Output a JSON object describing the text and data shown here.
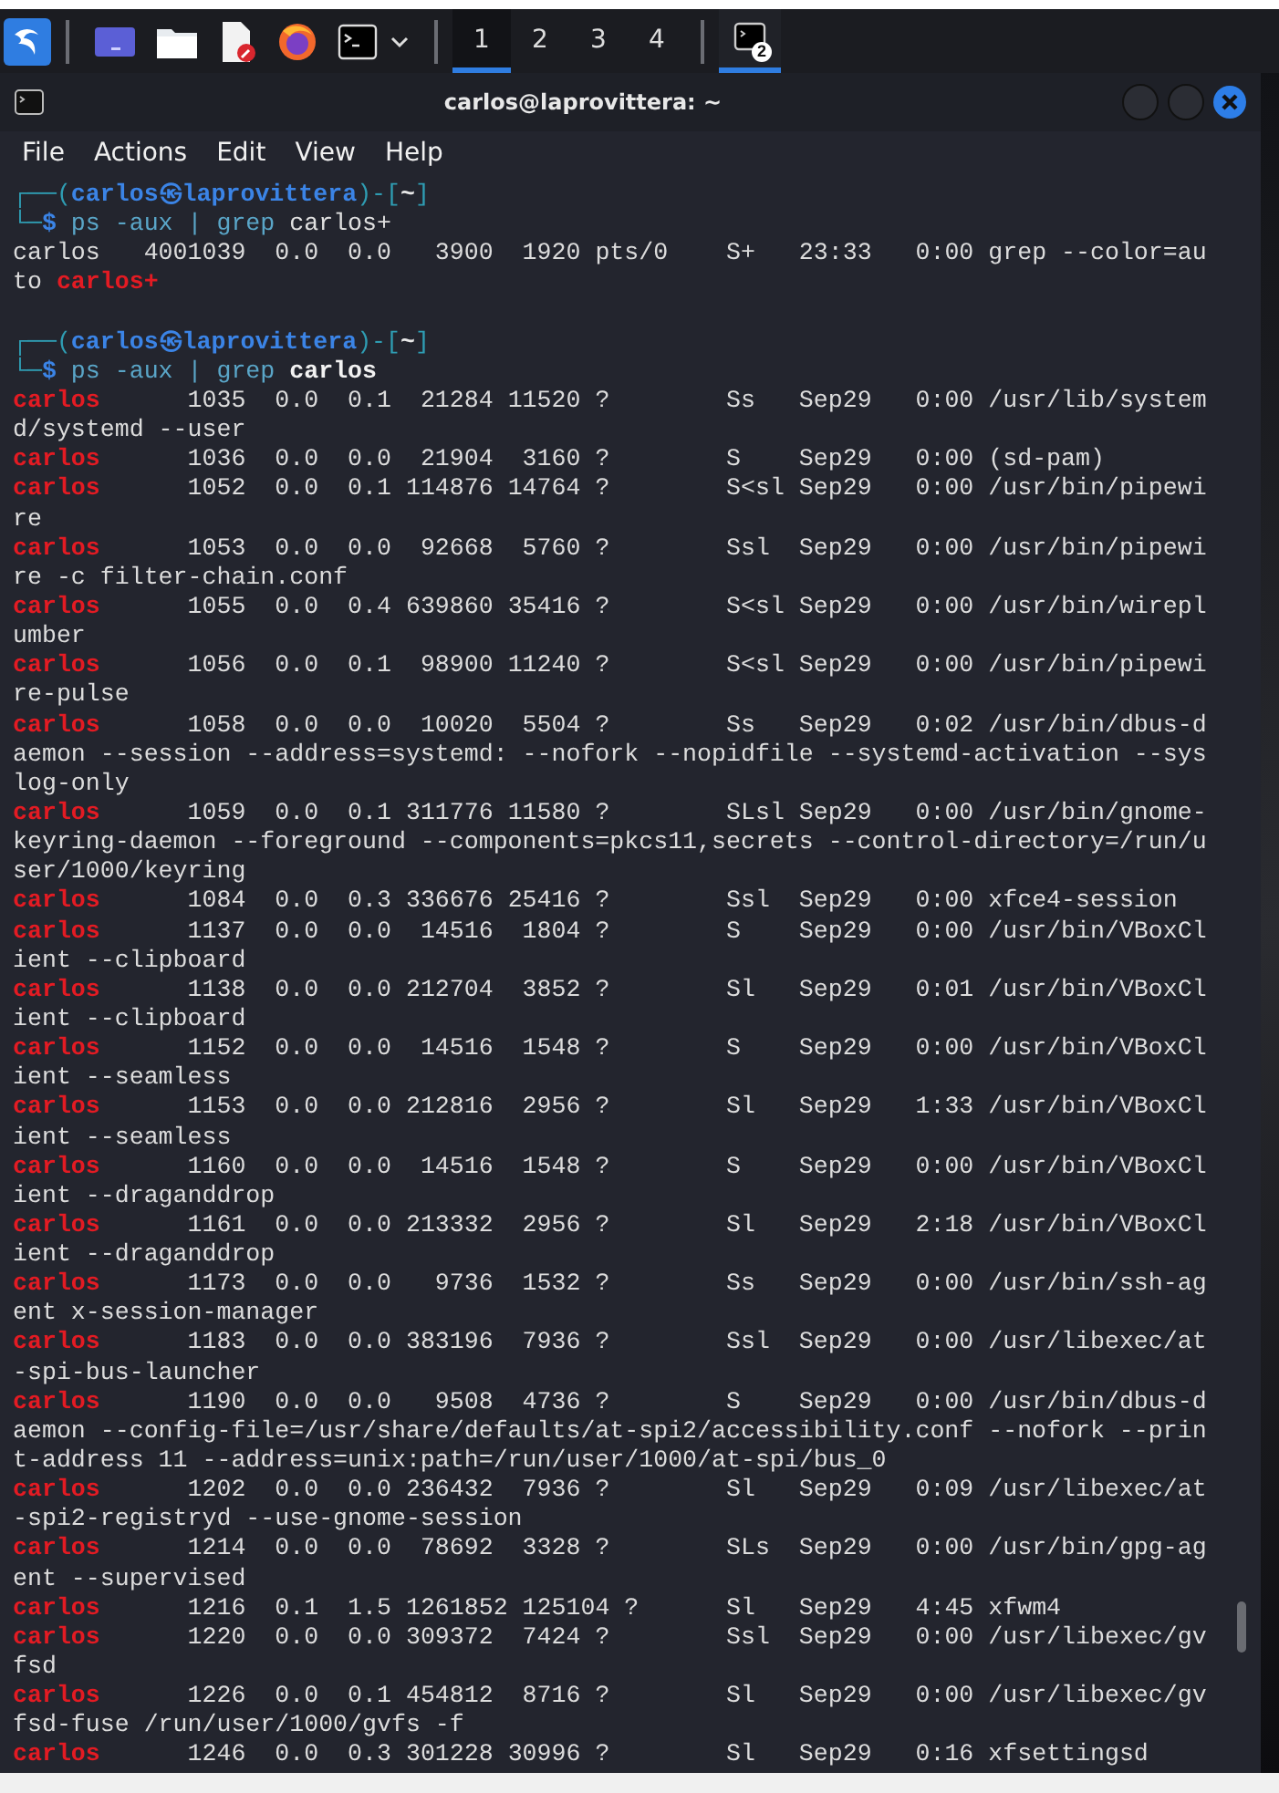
{
  "taskbar": {
    "workspaces": [
      {
        "label": "1",
        "selected": true
      },
      {
        "label": "2",
        "selected": false
      },
      {
        "label": "3",
        "selected": false
      },
      {
        "label": "4",
        "selected": false
      }
    ],
    "task": {
      "badge": "2",
      "selected": true
    }
  },
  "window": {
    "title": "carlos@laprovittera: ~",
    "menu": [
      "File",
      "Actions",
      "Edit",
      "View",
      "Help"
    ],
    "terminal": {
      "lines": [
        {
          "kind": "prompt",
          "open": "┌──(",
          "host": "carlos㉿laprovittera",
          "mid": ")-[",
          "dir": "~",
          "close": "]"
        },
        {
          "kind": "command",
          "corner": "└─",
          "sign": "$",
          "program": " ps -aux | grep",
          "argument": " carlos+",
          "argument_bold": false
        },
        {
          "kind": "process",
          "user": "carlos",
          "user_matched": false,
          "pid": "4001039",
          "cpu": "0.0",
          "mem": "0.0",
          "vsz": "3900",
          "rss": "1920",
          "tty": "pts/0",
          "stat": "S+",
          "start": "23:33",
          "time": "0:00",
          "command_lines": [
            "grep --color=au",
            "to **carlos+**"
          ]
        },
        {
          "kind": "prompt",
          "open": "┌──(",
          "host": "carlos㉿laprovittera",
          "mid": ")-[",
          "dir": "~",
          "close": "]"
        },
        {
          "kind": "command",
          "corner": "└─",
          "sign": "$",
          "program": " ps -aux | grep",
          "argument": " carlos",
          "argument_bold": true
        },
        {
          "kind": "process",
          "user": "carlos",
          "user_matched": true,
          "pid": "1035",
          "cpu": "0.0",
          "mem": "0.1",
          "vsz": "21284",
          "rss": "11520",
          "tty": "?",
          "stat": "Ss",
          "start": "Sep29",
          "time": "0:00",
          "command_lines": [
            "/usr/lib/system",
            "d/systemd --user"
          ]
        },
        {
          "kind": "process",
          "user": "carlos",
          "user_matched": true,
          "pid": "1036",
          "cpu": "0.0",
          "mem": "0.0",
          "vsz": "21904",
          "rss": "3160",
          "tty": "?",
          "stat": "S",
          "start": "Sep29",
          "time": "0:00",
          "command_lines": [
            "(sd-pam)"
          ]
        },
        {
          "kind": "process",
          "user": "carlos",
          "user_matched": true,
          "pid": "1052",
          "cpu": "0.0",
          "mem": "0.1",
          "vsz": "114876",
          "rss": "14764",
          "tty": "?",
          "stat": "S<sl",
          "start": "Sep29",
          "time": "0:00",
          "command_lines": [
            "/usr/bin/pipewi",
            "re"
          ]
        },
        {
          "kind": "process",
          "user": "carlos",
          "user_matched": true,
          "pid": "1053",
          "cpu": "0.0",
          "mem": "0.0",
          "vsz": "92668",
          "rss": "5760",
          "tty": "?",
          "stat": "Ssl",
          "start": "Sep29",
          "time": "0:00",
          "command_lines": [
            "/usr/bin/pipewi",
            "re -c filter-chain.conf"
          ]
        },
        {
          "kind": "process",
          "user": "carlos",
          "user_matched": true,
          "pid": "1055",
          "cpu": "0.0",
          "mem": "0.4",
          "vsz": "639860",
          "rss": "35416",
          "tty": "?",
          "stat": "S<sl",
          "start": "Sep29",
          "time": "0:00",
          "command_lines": [
            "/usr/bin/wirepl",
            "umber"
          ]
        },
        {
          "kind": "process",
          "user": "carlos",
          "user_matched": true,
          "pid": "1056",
          "cpu": "0.0",
          "mem": "0.1",
          "vsz": "98900",
          "rss": "11240",
          "tty": "?",
          "stat": "S<sl",
          "start": "Sep29",
          "time": "0:00",
          "command_lines": [
            "/usr/bin/pipewi",
            "re-pulse"
          ]
        },
        {
          "kind": "process",
          "user": "carlos",
          "user_matched": true,
          "pid": "1058",
          "cpu": "0.0",
          "mem": "0.0",
          "vsz": "10020",
          "rss": "5504",
          "tty": "?",
          "stat": "Ss",
          "start": "Sep29",
          "time": "0:02",
          "command_lines": [
            "/usr/bin/dbus-d",
            "aemon --session --address=systemd: --nofork --nopidfile --systemd-activation --sys",
            "log-only"
          ]
        },
        {
          "kind": "process",
          "user": "carlos",
          "user_matched": true,
          "pid": "1059",
          "cpu": "0.0",
          "mem": "0.1",
          "vsz": "311776",
          "rss": "11580",
          "tty": "?",
          "stat": "SLsl",
          "start": "Sep29",
          "time": "0:00",
          "command_lines": [
            "/usr/bin/gnome-",
            "keyring-daemon --foreground --components=pkcs11,secrets --control-directory=/run/u",
            "ser/1000/keyring"
          ]
        },
        {
          "kind": "process",
          "user": "carlos",
          "user_matched": true,
          "pid": "1084",
          "cpu": "0.0",
          "mem": "0.3",
          "vsz": "336676",
          "rss": "25416",
          "tty": "?",
          "stat": "Ssl",
          "start": "Sep29",
          "time": "0:00",
          "command_lines": [
            "xfce4-session"
          ]
        },
        {
          "kind": "process",
          "user": "carlos",
          "user_matched": true,
          "pid": "1137",
          "cpu": "0.0",
          "mem": "0.0",
          "vsz": "14516",
          "rss": "1804",
          "tty": "?",
          "stat": "S",
          "start": "Sep29",
          "time": "0:00",
          "command_lines": [
            "/usr/bin/VBoxCl",
            "ient --clipboard"
          ]
        },
        {
          "kind": "process",
          "user": "carlos",
          "user_matched": true,
          "pid": "1138",
          "cpu": "0.0",
          "mem": "0.0",
          "vsz": "212704",
          "rss": "3852",
          "tty": "?",
          "stat": "Sl",
          "start": "Sep29",
          "time": "0:01",
          "command_lines": [
            "/usr/bin/VBoxCl",
            "ient --clipboard"
          ]
        },
        {
          "kind": "process",
          "user": "carlos",
          "user_matched": true,
          "pid": "1152",
          "cpu": "0.0",
          "mem": "0.0",
          "vsz": "14516",
          "rss": "1548",
          "tty": "?",
          "stat": "S",
          "start": "Sep29",
          "time": "0:00",
          "command_lines": [
            "/usr/bin/VBoxCl",
            "ient --seamless"
          ]
        },
        {
          "kind": "process",
          "user": "carlos",
          "user_matched": true,
          "pid": "1153",
          "cpu": "0.0",
          "mem": "0.0",
          "vsz": "212816",
          "rss": "2956",
          "tty": "?",
          "stat": "Sl",
          "start": "Sep29",
          "time": "1:33",
          "command_lines": [
            "/usr/bin/VBoxCl",
            "ient --seamless"
          ]
        },
        {
          "kind": "process",
          "user": "carlos",
          "user_matched": true,
          "pid": "1160",
          "cpu": "0.0",
          "mem": "0.0",
          "vsz": "14516",
          "rss": "1548",
          "tty": "?",
          "stat": "S",
          "start": "Sep29",
          "time": "0:00",
          "command_lines": [
            "/usr/bin/VBoxCl",
            "ient --draganddrop"
          ]
        },
        {
          "kind": "process",
          "user": "carlos",
          "user_matched": true,
          "pid": "1161",
          "cpu": "0.0",
          "mem": "0.0",
          "vsz": "213332",
          "rss": "2956",
          "tty": "?",
          "stat": "Sl",
          "start": "Sep29",
          "time": "2:18",
          "command_lines": [
            "/usr/bin/VBoxCl",
            "ient --draganddrop"
          ]
        },
        {
          "kind": "process",
          "user": "carlos",
          "user_matched": true,
          "pid": "1173",
          "cpu": "0.0",
          "mem": "0.0",
          "vsz": "9736",
          "rss": "1532",
          "tty": "?",
          "stat": "Ss",
          "start": "Sep29",
          "time": "0:00",
          "command_lines": [
            "/usr/bin/ssh-ag",
            "ent x-session-manager"
          ]
        },
        {
          "kind": "process",
          "user": "carlos",
          "user_matched": true,
          "pid": "1183",
          "cpu": "0.0",
          "mem": "0.0",
          "vsz": "383196",
          "rss": "7936",
          "tty": "?",
          "stat": "Ssl",
          "start": "Sep29",
          "time": "0:00",
          "command_lines": [
            "/usr/libexec/at",
            "-spi-bus-launcher"
          ]
        },
        {
          "kind": "process",
          "user": "carlos",
          "user_matched": true,
          "pid": "1190",
          "cpu": "0.0",
          "mem": "0.0",
          "vsz": "9508",
          "rss": "4736",
          "tty": "?",
          "stat": "S",
          "start": "Sep29",
          "time": "0:00",
          "command_lines": [
            "/usr/bin/dbus-d",
            "aemon --config-file=/usr/share/defaults/at-spi2/accessibility.conf --nofork --prin",
            "t-address 11 --address=unix:path=/run/user/1000/at-spi/bus_0"
          ]
        },
        {
          "kind": "process",
          "user": "carlos",
          "user_matched": true,
          "pid": "1202",
          "cpu": "0.0",
          "mem": "0.0",
          "vsz": "236432",
          "rss": "7936",
          "tty": "?",
          "stat": "Sl",
          "start": "Sep29",
          "time": "0:09",
          "command_lines": [
            "/usr/libexec/at",
            "-spi2-registryd --use-gnome-session"
          ]
        },
        {
          "kind": "process",
          "user": "carlos",
          "user_matched": true,
          "pid": "1214",
          "cpu": "0.0",
          "mem": "0.0",
          "vsz": "78692",
          "rss": "3328",
          "tty": "?",
          "stat": "SLs",
          "start": "Sep29",
          "time": "0:00",
          "command_lines": [
            "/usr/bin/gpg-ag",
            "ent --supervised"
          ]
        },
        {
          "kind": "process",
          "user": "carlos",
          "user_matched": true,
          "pid": "1216",
          "cpu": "0.1",
          "mem": "1.5",
          "vsz": "1261852",
          "rss": "125104",
          "tty": "?",
          "stat": "Sl",
          "start": "Sep29",
          "time": "4:45",
          "command_lines": [
            "xfwm4"
          ]
        },
        {
          "kind": "process",
          "user": "carlos",
          "user_matched": true,
          "pid": "1220",
          "cpu": "0.0",
          "mem": "0.0",
          "vsz": "309372",
          "rss": "7424",
          "tty": "?",
          "stat": "Ssl",
          "start": "Sep29",
          "time": "0:00",
          "command_lines": [
            "/usr/libexec/gv",
            "fsd"
          ]
        },
        {
          "kind": "process",
          "user": "carlos",
          "user_matched": true,
          "pid": "1226",
          "cpu": "0.0",
          "mem": "0.1",
          "vsz": "454812",
          "rss": "8716",
          "tty": "?",
          "stat": "Sl",
          "start": "Sep29",
          "time": "0:00",
          "command_lines": [
            "/usr/libexec/gv",
            "fsd-fuse /run/user/1000/gvfs -f"
          ]
        },
        {
          "kind": "process",
          "user": "carlos",
          "user_matched": true,
          "pid": "1246",
          "cpu": "0.0",
          "mem": "0.3",
          "vsz": "301228",
          "rss": "30996",
          "tty": "?",
          "stat": "Sl",
          "start": "Sep29",
          "time": "0:16",
          "command_lines": [
            "xfsettingsd"
          ]
        }
      ]
    }
  }
}
